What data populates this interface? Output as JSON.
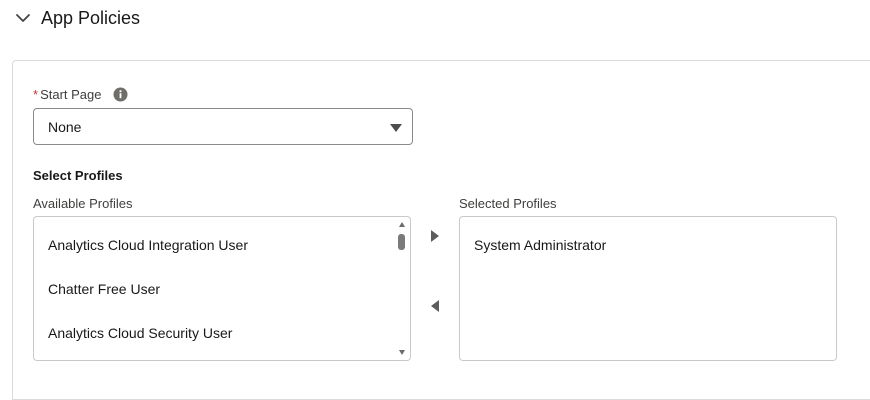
{
  "section": {
    "title": "App Policies",
    "icon": "chevron-down-icon"
  },
  "start_page": {
    "required_marker": "*",
    "label": "Start Page",
    "info_icon": "info-icon",
    "selected_value": "None"
  },
  "profiles": {
    "title": "Select Profiles",
    "available_label": "Available Profiles",
    "selected_label": "Selected Profiles",
    "available": [
      "Analytics Cloud Integration User",
      "Chatter Free User",
      "Analytics Cloud Security User"
    ],
    "selected": [
      "System Administrator"
    ],
    "move_right_icon": "move-right-icon",
    "move_left_icon": "move-left-icon"
  },
  "colors": {
    "required": "#c23934",
    "border": "#dddbda",
    "text": "#181818"
  }
}
